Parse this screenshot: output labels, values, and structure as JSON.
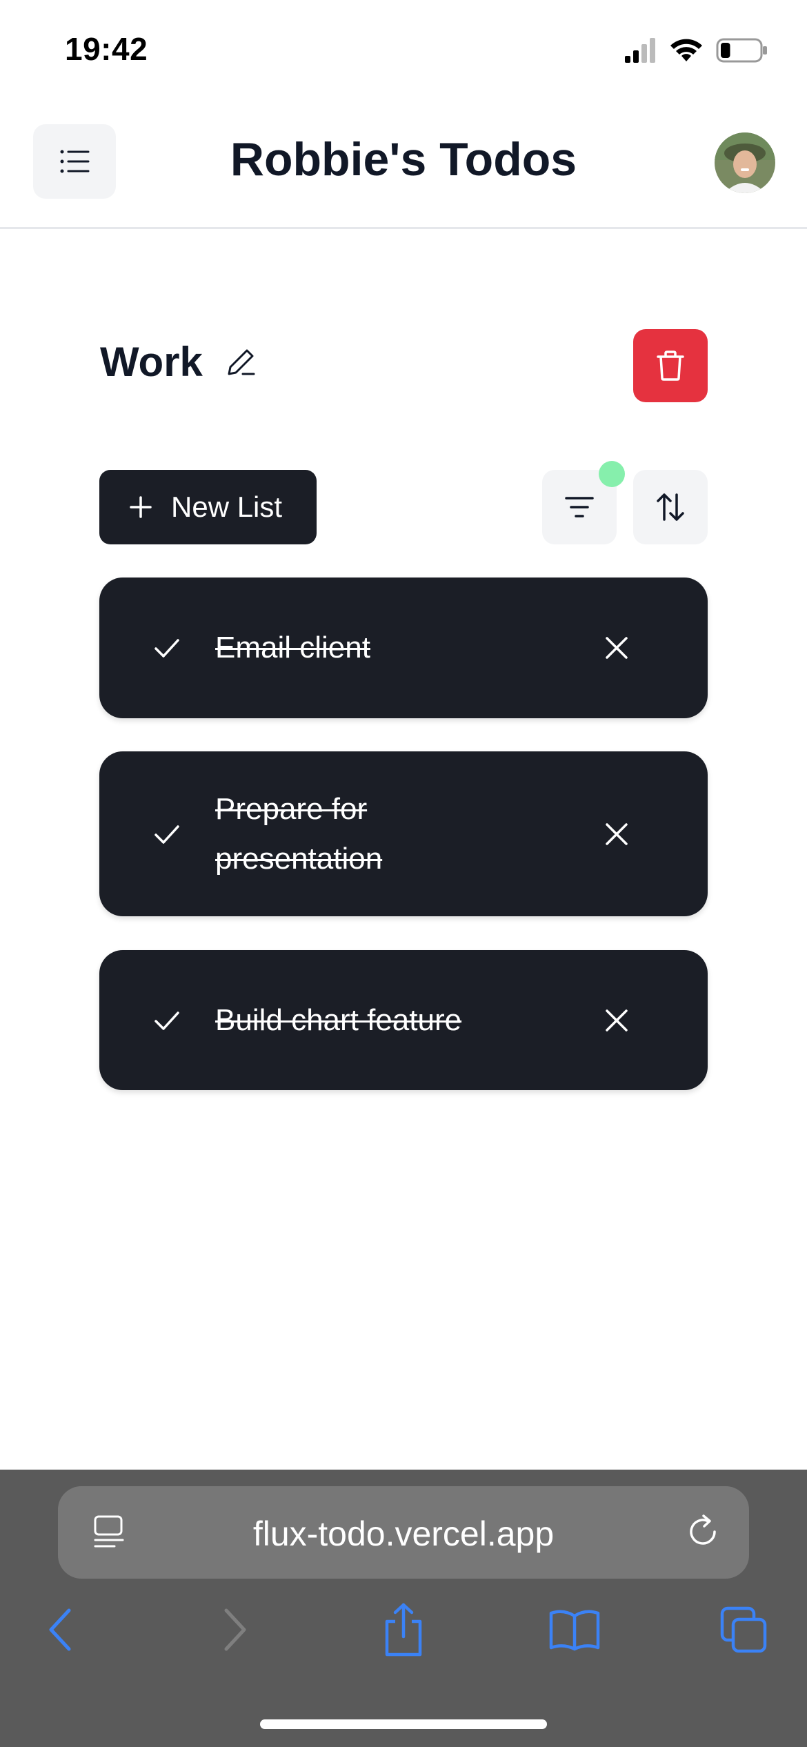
{
  "status_bar": {
    "time": "19:42",
    "icons": [
      "cellular-signal-icon",
      "wifi-icon",
      "battery-icon"
    ],
    "battery_level": 0.25
  },
  "header": {
    "menu_icon": "list-menu-icon",
    "title": "Robbie's Todos",
    "avatar": "user-avatar"
  },
  "list": {
    "name": "Work",
    "edit_icon": "pencil-icon",
    "delete_icon": "trash-icon",
    "delete_color": "#e5323f"
  },
  "toolbar": {
    "new_list_label": "New List",
    "new_list_icon": "plus-icon",
    "filter_icon": "filter-icon",
    "filter_active_color": "#86efac",
    "sort_icon": "sort-arrows-icon"
  },
  "todos": [
    {
      "text": "Email client",
      "completed": true
    },
    {
      "text": "Prepare for presentation",
      "completed": true
    },
    {
      "text": "Build chart feature",
      "completed": true
    }
  ],
  "browser": {
    "url": "flux-todo.vercel.app",
    "reader_icon": "page-menu-icon",
    "reload_icon": "reload-icon",
    "nav_icons": [
      "back-icon",
      "forward-icon",
      "share-icon",
      "bookmarks-icon",
      "tabs-icon"
    ],
    "accent": "#3b82f6"
  },
  "colors": {
    "card_bg": "#1b1e26",
    "text_dark": "#111827"
  }
}
